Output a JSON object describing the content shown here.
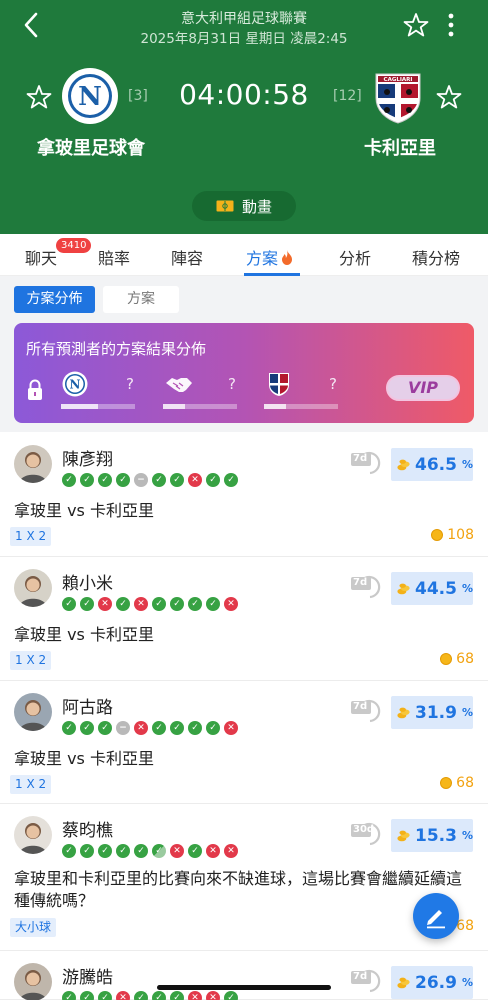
{
  "header": {
    "league": "意大利甲組足球聯賽",
    "datetime": "2025年8月31日 星期日 凌晨2:45",
    "countdown": "04:00:58",
    "home_team": "拿玻里足球會",
    "home_rank": "[3]",
    "away_team": "卡利亞里",
    "away_rank": "[12]",
    "animation_label": "動畫"
  },
  "tabs": {
    "chat": "聊天",
    "chat_badge": "3410",
    "odds": "賠率",
    "lineup": "陣容",
    "plan": "方案",
    "analysis": "分析",
    "standings": "積分榜"
  },
  "sub_tabs": {
    "distribution": "方案分佈",
    "plan": "方案"
  },
  "distribution": {
    "title": "所有預測者的方案結果分佈",
    "home_q": "?",
    "draw_q": "?",
    "away_q": "?",
    "vip_label": "VIP",
    "bars": [
      0.5,
      0.3,
      0.3
    ]
  },
  "items": [
    {
      "name": "陳彥翔",
      "results": [
        "w",
        "w",
        "w",
        "w",
        "d",
        "w",
        "w",
        "l",
        "w",
        "w"
      ],
      "period": "7d",
      "rate": "46.5",
      "rate_unit": "%",
      "match": "拿玻里 vs 卡利亞里",
      "tag": "1 X 2",
      "price": "108"
    },
    {
      "name": "賴小米",
      "results": [
        "w",
        "w",
        "l",
        "w",
        "l",
        "w",
        "w",
        "w",
        "w",
        "l"
      ],
      "period": "7d",
      "rate": "44.5",
      "rate_unit": "%",
      "match": "拿玻里 vs 卡利亞里",
      "tag": "1 X 2",
      "price": "68"
    },
    {
      "name": "阿古路",
      "results": [
        "w",
        "w",
        "w",
        "d",
        "l",
        "w",
        "w",
        "w",
        "w",
        "l"
      ],
      "period": "7d",
      "rate": "31.9",
      "rate_unit": "%",
      "match": "拿玻里 vs 卡利亞里",
      "tag": "1 X 2",
      "price": "68"
    },
    {
      "name": "蔡昀樵",
      "results": [
        "w",
        "w",
        "w",
        "w",
        "w",
        "h",
        "l",
        "w",
        "l",
        "l"
      ],
      "period": "30d",
      "rate": "15.3",
      "rate_unit": "%",
      "match": "拿玻里和卡利亞里的比賽向來不缺進球，這場比賽會繼續延續這種傳統嗎？",
      "tag": "大小球",
      "price": "68"
    },
    {
      "name": "游騰皓",
      "results": [
        "w",
        "w",
        "w",
        "l",
        "w",
        "w",
        "w",
        "l",
        "l",
        "w"
      ],
      "period": "7d",
      "rate": "26.9",
      "rate_unit": "%"
    }
  ],
  "colors": {
    "header_green": "#1f7a3c",
    "accent_blue": "#1f74e0",
    "win": "#37a243",
    "loss": "#e2394a"
  }
}
